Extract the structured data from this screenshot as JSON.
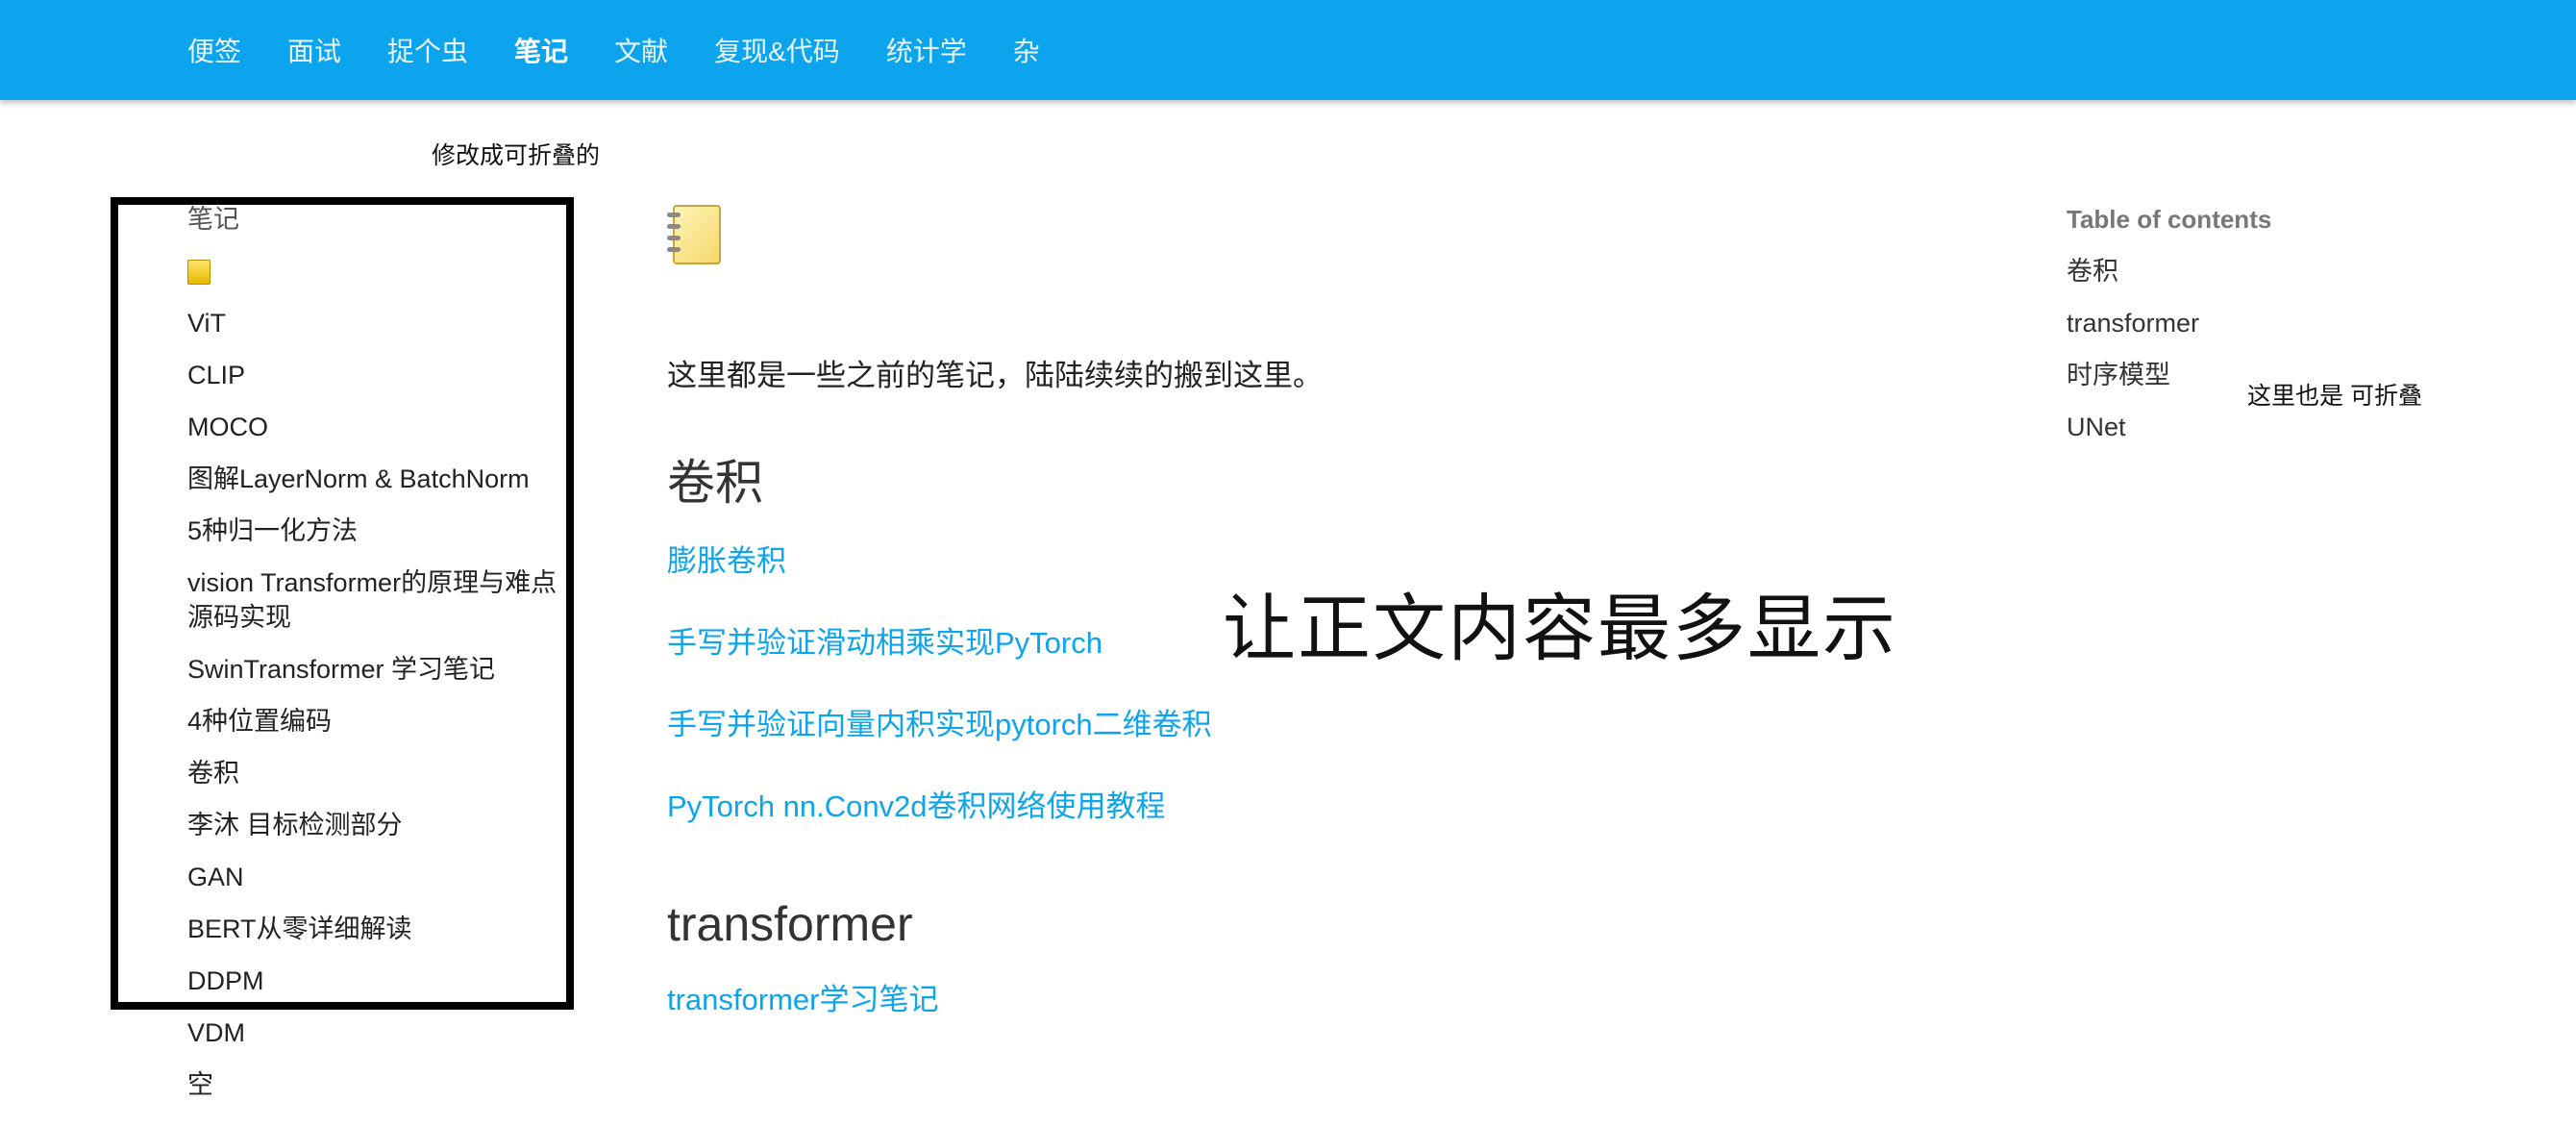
{
  "nav": {
    "items": [
      "便签",
      "面试",
      "捉个虫",
      "笔记",
      "文献",
      "复现&代码",
      "统计学",
      "杂"
    ],
    "active_index": 3
  },
  "annotations": {
    "sidebar_note": "修改成可折叠的",
    "content_note": "让正文内容最多显示",
    "toc_note": "这里也是 可折叠"
  },
  "sidebar": {
    "heading": "笔记",
    "icon": "notebook-icon",
    "items": [
      "ViT",
      "CLIP",
      "MOCO",
      "图解LayerNorm & BatchNorm",
      "5种归一化方法",
      "vision Transformer的原理与难点源码实现",
      "SwinTransformer 学习笔记",
      "4种位置编码",
      "卷积",
      "李沐 目标检测部分",
      "GAN",
      "BERT从零详细解读",
      "DDPM",
      "VDM",
      "空"
    ]
  },
  "content": {
    "icon": "notebook-icon",
    "intro": "这里都是一些之前的笔记，陆陆续续的搬到这里。",
    "sections": [
      {
        "title": "卷积",
        "links": [
          "膨胀卷积",
          "手写并验证滑动相乘实现PyTorch",
          "手写并验证向量内积实现pytorch二维卷积",
          "PyTorch nn.Conv2d卷积网络使用教程"
        ]
      },
      {
        "title": "transformer",
        "links": [
          "transformer学习笔记"
        ]
      }
    ]
  },
  "toc": {
    "title": "Table of contents",
    "items": [
      "卷积",
      "transformer",
      "时序模型",
      "UNet"
    ]
  },
  "colors": {
    "nav_bg": "#0ba4ed",
    "link": "#0ba4ed"
  }
}
